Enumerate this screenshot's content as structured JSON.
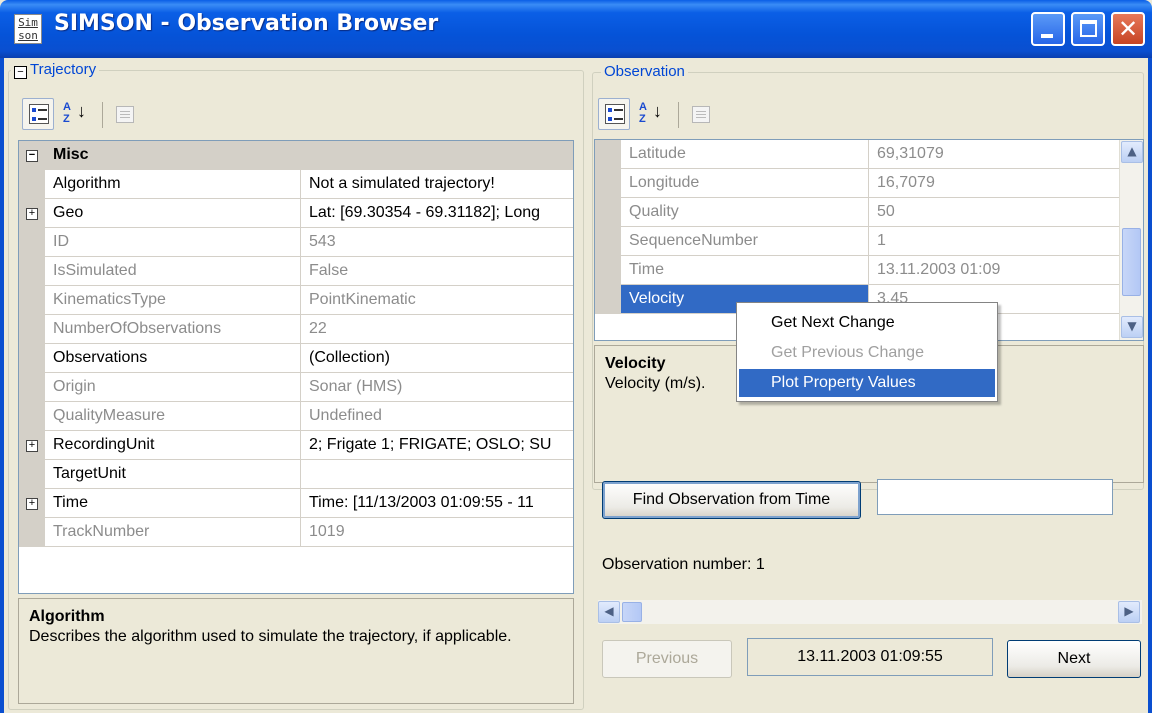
{
  "window": {
    "title": "SIMSON - Observation Browser",
    "app_icon_text": [
      "Sim",
      "son"
    ],
    "controls": {
      "minimize": "minimize-icon",
      "maximize": "maximize-icon",
      "close": "close-icon"
    },
    "colors": {
      "titlebar": "#0553d8",
      "selection": "#316ac5",
      "group_legend": "#0046d5"
    }
  },
  "trajectory": {
    "legend": "Trajectory",
    "collapse_glyph": "−",
    "toolbar": [
      "categorized-icon",
      "alphabetical-icon",
      "property-pages-icon"
    ],
    "category": "Misc",
    "rows": [
      {
        "name": "Algorithm",
        "value": "Not a simulated trajectory!",
        "readonly": false,
        "expandable": false
      },
      {
        "name": "Geo",
        "value": "Lat: [69.30354 - 69.31182]; Long",
        "readonly": false,
        "expandable": true
      },
      {
        "name": "ID",
        "value": "543",
        "readonly": true,
        "expandable": false
      },
      {
        "name": "IsSimulated",
        "value": "False",
        "readonly": true,
        "expandable": false
      },
      {
        "name": "KinematicsType",
        "value": "PointKinematic",
        "readonly": true,
        "expandable": false
      },
      {
        "name": "NumberOfObservations",
        "value": "22",
        "readonly": true,
        "expandable": false
      },
      {
        "name": "Observations",
        "value": "(Collection)",
        "readonly": false,
        "expandable": false
      },
      {
        "name": "Origin",
        "value": "Sonar (HMS)",
        "readonly": true,
        "expandable": false
      },
      {
        "name": "QualityMeasure",
        "value": "Undefined",
        "readonly": true,
        "expandable": false
      },
      {
        "name": "RecordingUnit",
        "value": "2; Frigate 1; FRIGATE; OSLO; SU",
        "readonly": false,
        "expandable": true
      },
      {
        "name": "TargetUnit",
        "value": "",
        "readonly": false,
        "expandable": false
      },
      {
        "name": "Time",
        "value": "Time: [11/13/2003 01:09:55 - 11",
        "readonly": false,
        "expandable": true
      },
      {
        "name": "TrackNumber",
        "value": "1019",
        "readonly": true,
        "expandable": false
      }
    ],
    "help": {
      "title": "Algorithm",
      "text": "Describes the algorithm used to simulate the trajectory, if applicable."
    }
  },
  "observation": {
    "legend": "Observation",
    "toolbar": [
      "categorized-icon",
      "alphabetical-icon",
      "property-pages-icon"
    ],
    "rows": [
      {
        "name": "Latitude",
        "value": "69,31079"
      },
      {
        "name": "Longitude",
        "value": "16,7079"
      },
      {
        "name": "Quality",
        "value": "50"
      },
      {
        "name": "SequenceNumber",
        "value": "1"
      },
      {
        "name": "Time",
        "value": "13.11.2003 01:09"
      },
      {
        "name": "Velocity",
        "value": "3,45"
      }
    ],
    "selected_row": "Velocity",
    "help": {
      "title": "Velocity",
      "text": "Velocity (m/s)."
    },
    "context_menu": [
      {
        "label": "Get Next Change",
        "enabled": true
      },
      {
        "label": "Get Previous Change",
        "enabled": false
      },
      {
        "label": "Plot Property Values",
        "enabled": true,
        "highlighted": true
      }
    ],
    "find_button": "Find Observation from Time",
    "find_input_value": "",
    "obs_number_label": "Observation number:",
    "obs_number_value": "1",
    "slider_fraction": 0.0,
    "previous_button": "Previous",
    "current_time": "13.11.2003 01:09:55",
    "next_button": "Next"
  }
}
